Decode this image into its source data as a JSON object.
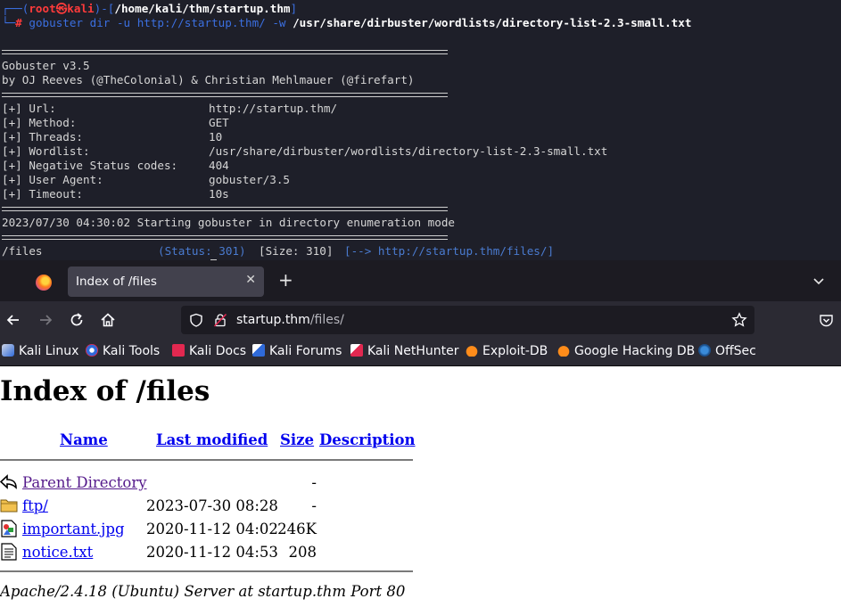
{
  "terminal": {
    "prompt": {
      "open": "┌──(",
      "user": "root",
      "at": "㉿",
      "host": "kali",
      "mid": ")-[",
      "cwd": "/home/kali/thm/startup.thm",
      "close": "]",
      "line2_prefix": "└─",
      "hash": "#"
    },
    "command": {
      "prog": "gobuster",
      "args": " dir -u http://startup.thm/ -w ",
      "wordlist": "/usr/share/dirbuster/wordlists/directory-list-2.3-small.txt"
    },
    "banner_line1": "Gobuster v3.5",
    "banner_line2": "by OJ Reeves (@TheColonial) & Christian Mehlmauer (@firefart)",
    "config": [
      {
        "label": "[+] Url:",
        "value": "http://startup.thm/"
      },
      {
        "label": "[+] Method:",
        "value": "GET"
      },
      {
        "label": "[+] Threads:",
        "value": "10"
      },
      {
        "label": "[+] Wordlist:",
        "value": "/usr/share/dirbuster/wordlists/directory-list-2.3-small.txt"
      },
      {
        "label": "[+] Negative Status codes:",
        "value": "404"
      },
      {
        "label": "[+] User Agent:",
        "value": "gobuster/3.5"
      },
      {
        "label": "[+] Timeout:",
        "value": "10s"
      }
    ],
    "start_msg": "2023/07/30 04:30:02 Starting gobuster in directory enumeration mode",
    "result": {
      "path": "/files",
      "status": "(Status: 301)",
      "size": "[Size: 310]",
      "redirect": "[--> http://startup.thm/files/]"
    }
  },
  "browser": {
    "tab_title": "Index of /files",
    "url_host": "startup.thm",
    "url_path": "/files/",
    "bookmarks": [
      {
        "label": "Kali Linux",
        "icon": "kali-dragon-icon"
      },
      {
        "label": "Kali Tools",
        "icon": "kali-tools-icon"
      },
      {
        "label": "Kali Docs",
        "icon": "kali-docs-icon"
      },
      {
        "label": "Kali Forums",
        "icon": "kali-forums-icon"
      },
      {
        "label": "Kali NetHunter",
        "icon": "kali-nethunter-icon"
      },
      {
        "label": "Exploit-DB",
        "icon": "exploit-db-icon"
      },
      {
        "label": "Google Hacking DB",
        "icon": "ghdb-icon"
      },
      {
        "label": "OffSec",
        "icon": "offsec-icon"
      }
    ]
  },
  "page": {
    "heading": "Index of /files",
    "columns": {
      "name": "Name",
      "modified": "Last modified",
      "size": "Size",
      "description": "Description"
    },
    "rows": [
      {
        "name": "Parent Directory",
        "modified": "",
        "size": "-",
        "icon": "back-arrow-icon",
        "visited": true
      },
      {
        "name": "ftp/",
        "modified": "2023-07-30 08:28",
        "size": "-",
        "icon": "folder-icon",
        "visited": false
      },
      {
        "name": "important.jpg",
        "modified": "2020-11-12 04:02",
        "size": "246K",
        "icon": "image-file-icon",
        "visited": false
      },
      {
        "name": "notice.txt",
        "modified": "2020-11-12 04:53",
        "size": "208",
        "icon": "text-file-icon",
        "visited": false
      }
    ],
    "footer": "Apache/2.4.18 (Ubuntu) Server at startup.thm Port 80"
  },
  "colors": {
    "link": "#0000ee",
    "visited": "#551a8b",
    "terminal_bg": "#1e1f29",
    "prompt_blue": "#3b6fe0",
    "prompt_red": "#ff3b3b"
  }
}
